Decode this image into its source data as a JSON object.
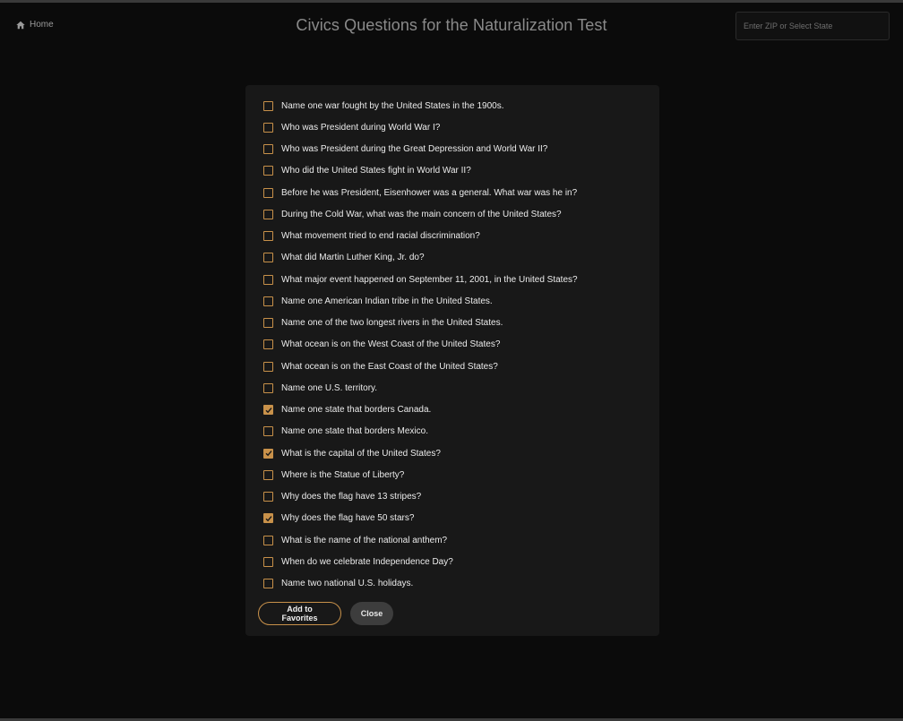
{
  "header": {
    "home_label": "Home",
    "title": "Civics Questions for the Naturalization Test",
    "zip_placeholder": "Enter ZIP or Select State"
  },
  "dialog": {
    "questions": [
      {
        "text": "Name one war fought by the United States in the 1900s.",
        "checked": false
      },
      {
        "text": "Who was President during World War I?",
        "checked": false
      },
      {
        "text": "Who was President during the Great Depression and World War II?",
        "checked": false
      },
      {
        "text": "Who did the United States fight in World War II?",
        "checked": false
      },
      {
        "text": "Before he was President, Eisenhower was a general. What war was he in?",
        "checked": false
      },
      {
        "text": "During the Cold War, what was the main concern of the United States?",
        "checked": false
      },
      {
        "text": "What movement tried to end racial discrimination?",
        "checked": false
      },
      {
        "text": "What did Martin Luther King, Jr. do?",
        "checked": false
      },
      {
        "text": "What major event happened on September 11, 2001, in the United States?",
        "checked": false
      },
      {
        "text": "Name one American Indian tribe in the United States.",
        "checked": false
      },
      {
        "text": "Name one of the two longest rivers in the United States.",
        "checked": false
      },
      {
        "text": "What ocean is on the West Coast of the United States?",
        "checked": false
      },
      {
        "text": "What ocean is on the East Coast of the United States?",
        "checked": false
      },
      {
        "text": "Name one U.S. territory.",
        "checked": false
      },
      {
        "text": "Name one state that borders Canada.",
        "checked": true
      },
      {
        "text": "Name one state that borders Mexico.",
        "checked": false
      },
      {
        "text": "What is the capital of the United States?",
        "checked": true
      },
      {
        "text": "Where is the Statue of Liberty?",
        "checked": false
      },
      {
        "text": "Why does the flag have 13 stripes?",
        "checked": false
      },
      {
        "text": "Why does the flag have 50 stars?",
        "checked": true
      },
      {
        "text": "What is the name of the national anthem?",
        "checked": false
      },
      {
        "text": "When do we celebrate Independence Day?",
        "checked": false
      },
      {
        "text": "Name two national U.S. holidays.",
        "checked": false
      }
    ],
    "add_favorites_label": "Add to Favorites",
    "close_label": "Close"
  },
  "colors": {
    "accent": "#c8914a",
    "background": "#0b0b0b",
    "dialog_bg": "#181818",
    "close_button_bg": "#3d3d3d"
  },
  "icons": {
    "home": "home-icon",
    "checkbox": "checkbox-icon",
    "check": "check-icon"
  }
}
